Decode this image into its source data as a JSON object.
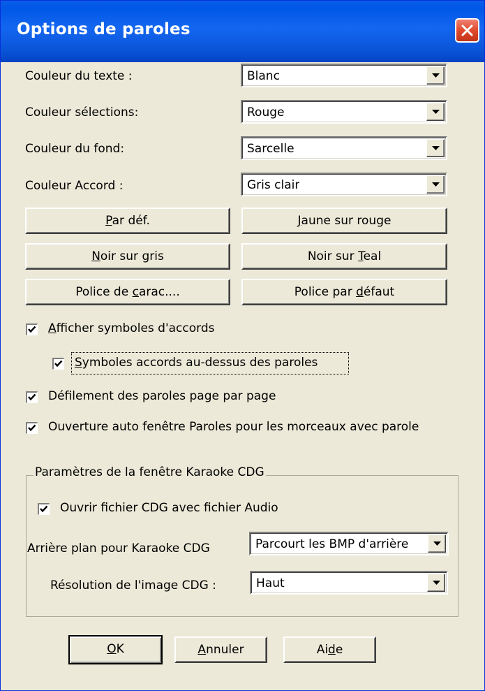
{
  "dialog": {
    "title": "Options de paroles",
    "close_icon": "close-icon"
  },
  "colors": {
    "titlebar": "#0058e6",
    "dialog_bg": "#ece9d8",
    "close_button": "#e04a2e"
  },
  "fields": {
    "text_color": {
      "label": "Couleur du texte :",
      "value": "Blanc"
    },
    "selection_color": {
      "label": "Couleur sélections:",
      "value": "Rouge"
    },
    "background_color": {
      "label": "Couleur du fond:",
      "value": "Sarcelle"
    },
    "chord_color": {
      "label": "Couleur Accord :",
      "value": "Gris clair"
    }
  },
  "buttons": {
    "default": {
      "pre": "",
      "key": "P",
      "post": "ar déf."
    },
    "yellow_on_red": {
      "pre": "",
      "key": "J",
      "post": "aune sur rouge"
    },
    "black_on_gray": {
      "pre": "",
      "key": "N",
      "post": "oir sur gris"
    },
    "black_on_teal": {
      "pre": "Noir sur ",
      "key": "T",
      "post": "eal"
    },
    "font": {
      "pre": "Police de ",
      "key": "c",
      "post": "arac...."
    },
    "default_font": {
      "pre": "Police par ",
      "key": "d",
      "post": "éfaut"
    }
  },
  "checkboxes": {
    "show_chord_symbols": {
      "key": "A",
      "post": "fficher symboles d'accords",
      "checked": true
    },
    "chords_above_lyrics": {
      "key": "S",
      "post": "ymboles accords au-dessus des paroles",
      "checked": true
    },
    "page_scroll": {
      "label": "Défilement des paroles page par page",
      "checked": true
    },
    "auto_open_lyrics": {
      "label": "Ouverture auto fenêtre Paroles pour les morceaux avec parole",
      "checked": true
    }
  },
  "karaoke": {
    "group_title": "Paramètres de la fenêtre Karaoke CDG",
    "open_cdg": {
      "label": "Ouvrir fichier CDG avec fichier Audio",
      "checked": true
    },
    "background": {
      "label": "Arrière plan pour Karaoke CDG",
      "value": "Parcourt les BMP d'arrière"
    },
    "resolution": {
      "label": "Résolution de l'image CDG :",
      "value": "Haut"
    }
  },
  "footer": {
    "ok": {
      "key": "O",
      "post": "K"
    },
    "cancel": {
      "key": "A",
      "post": "nnuler"
    },
    "help": {
      "pre": "Ai",
      "key": "d",
      "post": "e"
    }
  }
}
